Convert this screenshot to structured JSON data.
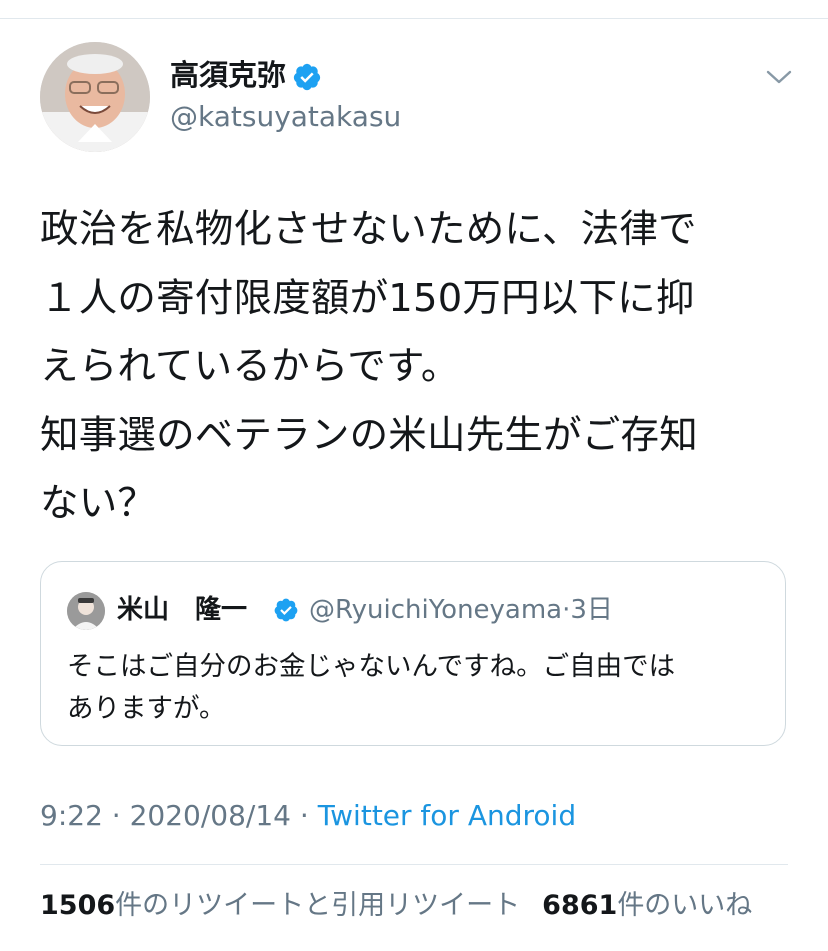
{
  "author": {
    "display_name": "高須克弥",
    "handle": "@katsuyatakasu",
    "verified": true
  },
  "tweet": {
    "text": "政治を私物化させないために、法律で\n１人の寄付限度額が150万円以下に抑\nえられているからです。\n知事選のベテランの米山先生がご存知\nない？"
  },
  "quoted_tweet": {
    "display_name": "米山　隆一",
    "handle": "@RyuichiYoneyama",
    "separator": "·",
    "age": "3日",
    "text": "そこはご自分のお金じゃないんですね。ご自由では\nありますが。"
  },
  "meta": {
    "time": "9:22",
    "date": "2020/08/14",
    "separator": " · ",
    "source": "Twitter for Android"
  },
  "stats": {
    "retweets_count": "1506",
    "retweets_label": "件のリツイートと引用リツイート",
    "likes_count": "6861",
    "likes_label": "件のいいね"
  },
  "colors": {
    "text_primary": "#14171a",
    "text_secondary": "#657786",
    "link": "#1b95e0",
    "verified": "#1da1f2",
    "divider": "#e1e8ed"
  },
  "icons": {
    "verified": "verified-badge-icon",
    "menu": "chevron-down-icon"
  }
}
